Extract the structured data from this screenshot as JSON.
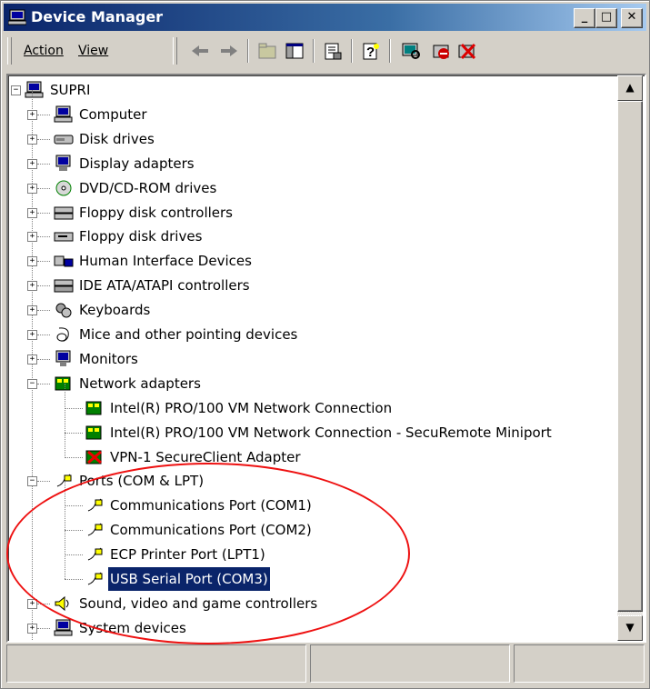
{
  "window": {
    "title": "Device Manager"
  },
  "controls": {
    "minimize": "_",
    "maximize": "□",
    "close": "✕"
  },
  "menu": {
    "action": "Action",
    "view": "View"
  },
  "toolbar_icons": [
    "back-arrow-icon",
    "forward-arrow-icon",
    "up-folder-icon",
    "show-hide-tree-icon",
    "properties-icon",
    "help-icon",
    "scan-hardware-icon",
    "disable-device-icon",
    "uninstall-device-icon"
  ],
  "tree": {
    "root": "SUPRI",
    "categories": [
      {
        "label": "Computer",
        "icon": "computer-icon"
      },
      {
        "label": "Disk drives",
        "icon": "disk-drive-icon"
      },
      {
        "label": "Display adapters",
        "icon": "display-adapter-icon"
      },
      {
        "label": "DVD/CD-ROM drives",
        "icon": "dvd-drive-icon"
      },
      {
        "label": "Floppy disk controllers",
        "icon": "floppy-controller-icon"
      },
      {
        "label": "Floppy disk drives",
        "icon": "floppy-drive-icon"
      },
      {
        "label": "Human Interface Devices",
        "icon": "hid-icon"
      },
      {
        "label": "IDE ATA/ATAPI controllers",
        "icon": "ide-controller-icon"
      },
      {
        "label": "Keyboards",
        "icon": "keyboard-icon"
      },
      {
        "label": "Mice and other pointing devices",
        "icon": "mouse-icon"
      },
      {
        "label": "Monitors",
        "icon": "monitor-icon"
      },
      {
        "label": "Network adapters",
        "icon": "network-adapter-icon"
      },
      {
        "label": "Ports (COM & LPT)",
        "icon": "port-icon"
      },
      {
        "label": "Sound, video and game controllers",
        "icon": "sound-icon"
      },
      {
        "label": "System devices",
        "icon": "system-icon"
      }
    ],
    "network_children": [
      "Intel(R) PRO/100 VM Network Connection",
      "Intel(R) PRO/100 VM Network Connection - SecuRemote Miniport",
      "VPN-1 SecureClient Adapter"
    ],
    "ports_children": [
      "Communications Port (COM1)",
      "Communications Port (COM2)",
      "ECP Printer Port (LPT1)",
      "USB Serial Port (COM3)"
    ],
    "selected": "USB Serial Port (COM3)"
  },
  "colors": {
    "selection": "#0a246a",
    "annotation": "#e11111",
    "titlebar": "#0a246a"
  }
}
